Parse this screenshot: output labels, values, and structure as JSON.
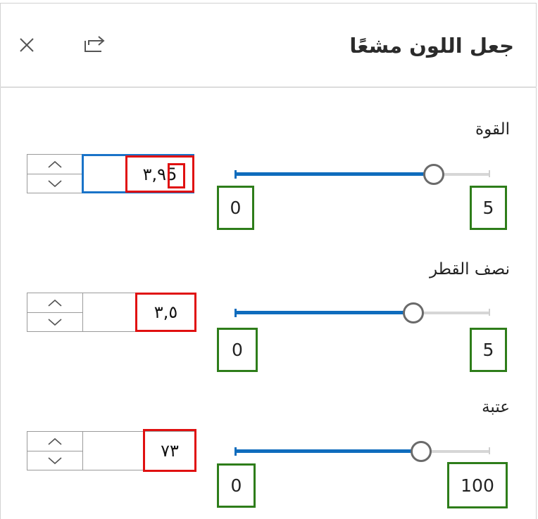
{
  "header": {
    "title": "جعل اللون مشعًا",
    "close_icon": "close-icon",
    "share_icon": "share-arrow-icon"
  },
  "controls": [
    {
      "label": "القوة",
      "value": "٣,٩5",
      "min": "0",
      "max": "5",
      "fraction": 0.78
    },
    {
      "label": "نصف القطر",
      "value": "٣,٥",
      "min": "0",
      "max": "5",
      "fraction": 0.7
    },
    {
      "label": "عتبة",
      "value": "٧٣",
      "min": "0",
      "max": "100",
      "fraction": 0.73
    }
  ],
  "colors": {
    "accent": "#0f6cbd",
    "track": "#d6d6d6",
    "highlight_red": "#e01010",
    "highlight_green": "#2e7d1a"
  }
}
